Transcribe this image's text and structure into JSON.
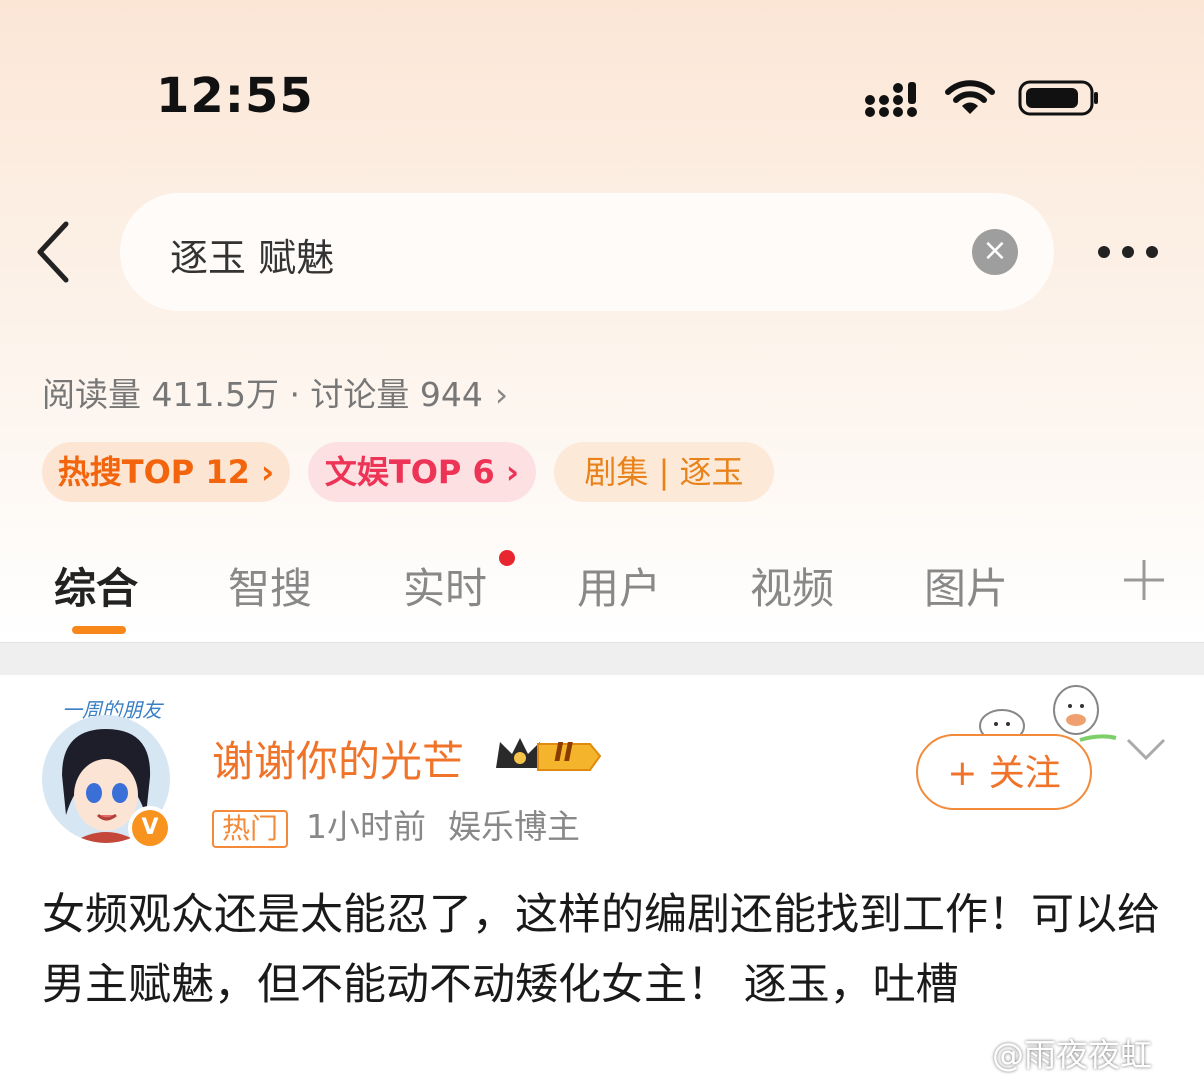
{
  "status_bar": {
    "time": "12:55"
  },
  "search": {
    "query": "逐玉 赋魅",
    "clear_icon": "close-icon"
  },
  "stats": {
    "text": "阅读量 411.5万 · 讨论量 944",
    "chevron": "›"
  },
  "chips": [
    {
      "label": "热搜TOP 12 ›",
      "color": "#f2650c"
    },
    {
      "label": "文娱TOP 6 ›",
      "color": "#ee3456"
    },
    {
      "label": "剧集 | 逐玉",
      "color": "#e8821a"
    }
  ],
  "tabs": [
    {
      "label": "综合",
      "active": true
    },
    {
      "label": "智搜"
    },
    {
      "label": "实时",
      "has_dot": true
    },
    {
      "label": "用户"
    },
    {
      "label": "视频"
    },
    {
      "label": "图片"
    }
  ],
  "post": {
    "avatar_label": "一周的朋友",
    "verified_mark": "V",
    "username": "谢谢你的光芒",
    "level_badge": "II",
    "hot_tag": "热门",
    "time": "1小时前",
    "role": "娱乐博主",
    "follow_label": "+ 关注",
    "body": "女频观众还是太能忍了，这样的编剧还能找到工作！可以给男主赋魅，但不能动不动矮化女主！ 逐玉，吐槽"
  },
  "watermark": "@雨夜夜虹",
  "accent_color": "#f7861b"
}
